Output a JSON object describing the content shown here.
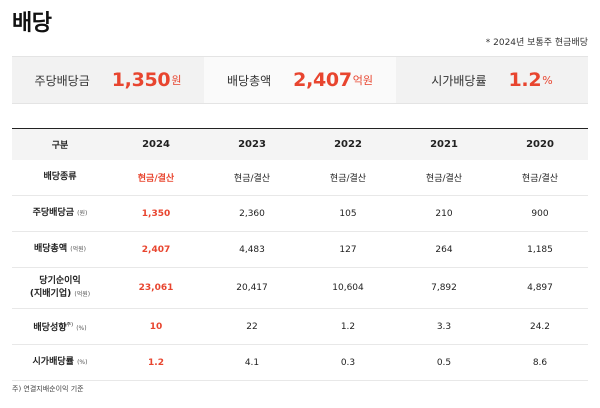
{
  "page": {
    "title": "배당",
    "note": "* 2024년 보통주 현금배당"
  },
  "summary": [
    {
      "label": "주당배당금",
      "value": "1,350",
      "unit": "원"
    },
    {
      "label": "배당총액",
      "value": "2,407",
      "unit": "억원"
    },
    {
      "label": "시가배당률",
      "value": "1.2",
      "unit": "%"
    }
  ],
  "table": {
    "headers": [
      "구분",
      "2024",
      "2023",
      "2022",
      "2021",
      "2020"
    ],
    "rows": [
      {
        "label": "배당종류",
        "sup": "",
        "unit": "",
        "values": [
          "현금/결산",
          "현금/결산",
          "현금/결산",
          "현금/결산",
          "현금/결산"
        ]
      },
      {
        "label": "주당배당금",
        "sup": "",
        "unit": "(원)",
        "values": [
          "1,350",
          "2,360",
          "105",
          "210",
          "900"
        ]
      },
      {
        "label": "배당총액",
        "sup": "",
        "unit": "(억원)",
        "values": [
          "2,407",
          "4,483",
          "127",
          "264",
          "1,185"
        ]
      },
      {
        "label": "당기순이익",
        "label2": "(지배기업)",
        "sup": "",
        "unit": "(억원)",
        "values": [
          "23,061",
          "20,417",
          "10,604",
          "7,892",
          "4,897"
        ]
      },
      {
        "label": "배당성향",
        "sup": "주)",
        "unit": "(%)",
        "values": [
          "10",
          "22",
          "1.2",
          "3.3",
          "24.2"
        ]
      },
      {
        "label": "시가배당률",
        "sup": "",
        "unit": "(%)",
        "values": [
          "1.2",
          "4.1",
          "0.3",
          "0.5",
          "8.6"
        ]
      }
    ]
  },
  "footnote": "주) 연결지배순이익 기준",
  "colors": {
    "accent": "#e8452f"
  }
}
